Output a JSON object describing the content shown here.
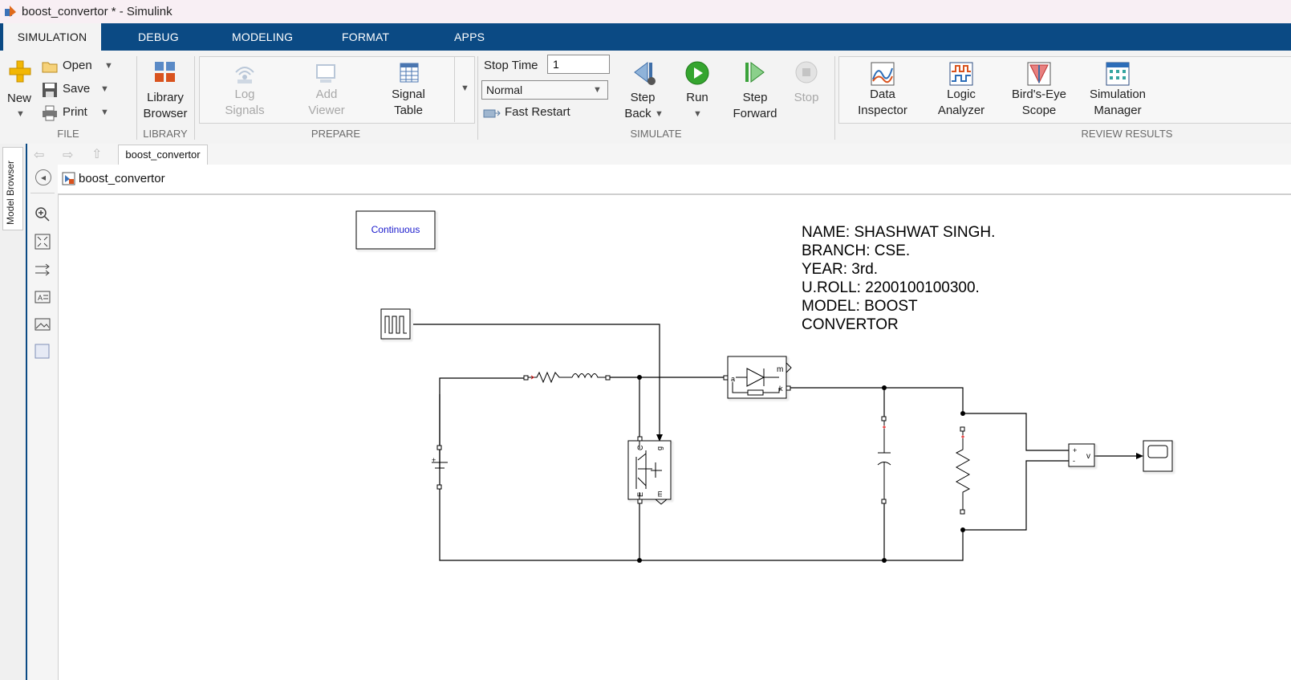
{
  "window": {
    "title": "boost_convertor * - Simulink"
  },
  "tabs": [
    {
      "label": "SIMULATION"
    },
    {
      "label": "DEBUG"
    },
    {
      "label": "MODELING"
    },
    {
      "label": "FORMAT"
    },
    {
      "label": "APPS"
    }
  ],
  "ribbon": {
    "file": {
      "new_label": "New",
      "open_label": "Open",
      "save_label": "Save",
      "print_label": "Print",
      "section": "FILE"
    },
    "library": {
      "browser_line1": "Library",
      "browser_line2": "Browser",
      "section": "LIBRARY"
    },
    "prepare": {
      "log_line1": "Log",
      "log_line2": "Signals",
      "add_line1": "Add",
      "add_line2": "Viewer",
      "table_line1": "Signal",
      "table_line2": "Table",
      "section": "PREPARE"
    },
    "simulate": {
      "stop_time_label": "Stop Time",
      "stop_time_value": "1",
      "mode_value": "Normal",
      "fast_restart_label": "Fast Restart",
      "step_back_line1": "Step",
      "step_back_line2": "Back",
      "run_label": "Run",
      "step_fwd_line1": "Step",
      "step_fwd_line2": "Forward",
      "stop_label": "Stop",
      "section": "SIMULATE"
    },
    "review": {
      "data_line1": "Data",
      "data_line2": "Inspector",
      "logic_line1": "Logic",
      "logic_line2": "Analyzer",
      "birds_line1": "Bird's-Eye",
      "birds_line2": "Scope",
      "simmgr_line1": "Simulation",
      "simmgr_line2": "Manager",
      "section": "REVIEW RESULTS"
    }
  },
  "sidebar": {
    "model_browser_label": "Model Browser"
  },
  "editor": {
    "doc_tab": "boost_convertor",
    "breadcrumb": "boost_convertor"
  },
  "diagram": {
    "powergui_label": "Continuous",
    "info_lines": [
      "NAME: SHASHWAT SINGH.",
      "BRANCH: CSE.",
      "YEAR: 3rd.",
      "U.ROLL: 2200100100300.",
      "MODEL: BOOST",
      "CONVERTOR"
    ],
    "port_m": "m",
    "port_a": "a",
    "port_k": "k",
    "port_c": "C",
    "port_g": "g",
    "port_e": "E",
    "port_m2": "m",
    "vm_label": "v",
    "plus": "+",
    "minus": "-"
  },
  "colors": {
    "ribbon_tab_bar": "#0b4a84",
    "powergui_text": "#1a1acc"
  }
}
